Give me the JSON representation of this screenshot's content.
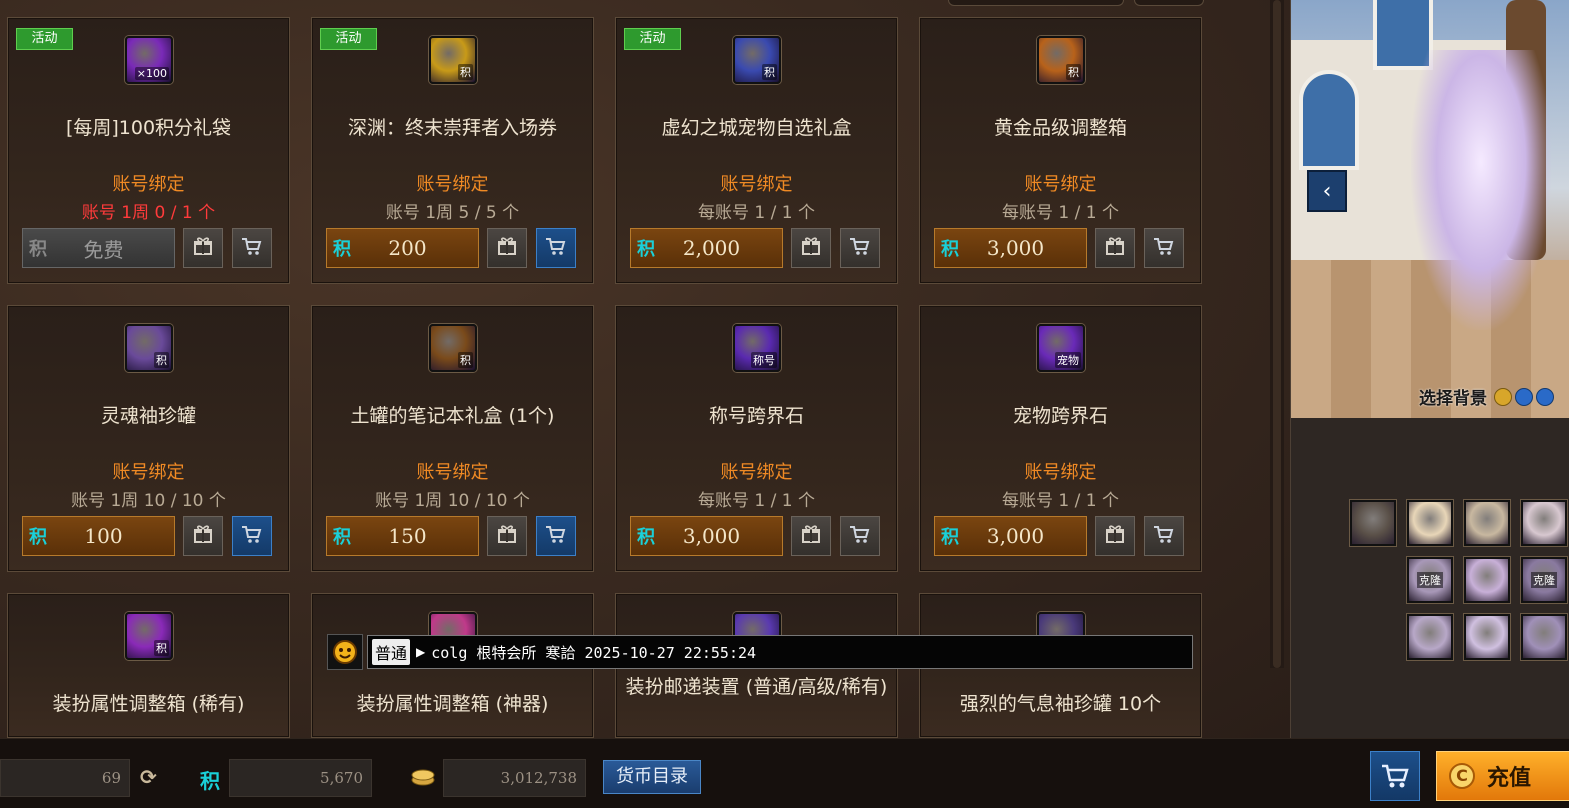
{
  "colors": {
    "accent_orange": "#f08a24",
    "limit_red": "#ff3b3b",
    "cart_blue": "#1d4f8a",
    "price_gold": "#7a4510",
    "event_green": "#2e9a2e"
  },
  "cards": [
    {
      "event": "活动",
      "icon_name": "points-bag-icon",
      "icon_badge": "×100",
      "icon_color": "#7a2ab8",
      "name": "[每周]100积分礼袋",
      "bind": "账号绑定",
      "limit": "账号 1周 0 / 1 个",
      "limit_red": true,
      "currency_symbol": "积",
      "price": "免费",
      "free": true,
      "cart_active": false
    },
    {
      "event": "活动",
      "icon_name": "ticket-icon",
      "icon_badge": "积",
      "icon_color": "#c89a18",
      "name": "深渊：终末崇拜者入场券",
      "bind": "账号绑定",
      "limit": "账号 1周 5 / 5 个",
      "limit_red": false,
      "currency_symbol": "积",
      "price": "200",
      "free": false,
      "cart_active": true
    },
    {
      "event": "活动",
      "icon_name": "pet-box-icon",
      "icon_badge": "积",
      "icon_color": "#3a4ab0",
      "name": "虚幻之城宠物自选礼盒",
      "bind": "账号绑定",
      "limit": "每账号 1 / 1 个",
      "limit_red": false,
      "currency_symbol": "积",
      "price": "2,000",
      "free": false,
      "cart_active": false
    },
    {
      "event": "",
      "icon_name": "gold-box-icon",
      "icon_badge": "积",
      "icon_color": "#b8621a",
      "name": "黄金品级调整箱",
      "bind": "账号绑定",
      "limit": "每账号 1 / 1 个",
      "limit_red": false,
      "currency_symbol": "积",
      "price": "3,000",
      "free": false,
      "cart_active": false
    },
    {
      "event": "",
      "icon_name": "jar-icon",
      "icon_badge": "积",
      "icon_color": "#6a4a9a",
      "name": "灵魂袖珍罐",
      "bind": "账号绑定",
      "limit": "账号 1周 10 / 10 个",
      "limit_red": false,
      "currency_symbol": "积",
      "price": "100",
      "free": false,
      "cart_active": true
    },
    {
      "event": "",
      "icon_name": "notebook-icon",
      "icon_badge": "积",
      "icon_color": "#7a4a1a",
      "name": "土罐的笔记本礼盒 (1个)",
      "bind": "账号绑定",
      "limit": "账号 1周 10 / 10 个",
      "limit_red": false,
      "currency_symbol": "积",
      "price": "150",
      "free": false,
      "cart_active": true
    },
    {
      "event": "",
      "icon_name": "title-stone-icon",
      "icon_badge": "称号",
      "icon_color": "#5a2ab0",
      "name": "称号跨界石",
      "bind": "账号绑定",
      "limit": "每账号 1 / 1 个",
      "limit_red": false,
      "currency_symbol": "积",
      "price": "3,000",
      "free": false,
      "cart_active": false
    },
    {
      "event": "",
      "icon_name": "pet-stone-icon",
      "icon_badge": "宠物",
      "icon_color": "#6a2ab8",
      "name": "宠物跨界石",
      "bind": "账号绑定",
      "limit": "每账号 1 / 1 个",
      "limit_red": false,
      "currency_symbol": "积",
      "price": "3,000",
      "free": false,
      "cart_active": false
    },
    {
      "event": "",
      "icon_name": "avatar-box-icon",
      "icon_badge": "积",
      "icon_color": "#8a2ab8",
      "name": "装扮属性调整箱 (稀有)",
      "bind": "",
      "limit": "",
      "limit_red": false,
      "currency_symbol": "",
      "price": "",
      "free": false,
      "cart_active": false
    },
    {
      "event": "",
      "icon_name": "avatar-box-artifact-icon",
      "icon_badge": "",
      "icon_color": "#c03a8a",
      "name": "装扮属性调整箱 (神器)",
      "bind": "",
      "limit": "",
      "limit_red": false,
      "currency_symbol": "",
      "price": "",
      "free": false,
      "cart_active": false
    },
    {
      "event": "",
      "icon_name": "mail-device-icon",
      "icon_badge": "",
      "icon_color": "#5a3ab0",
      "name": "装扮邮递装置 (普通/高级/稀有)",
      "bind": "",
      "limit": "",
      "limit_red": false,
      "currency_symbol": "",
      "price": "",
      "free": false,
      "cart_active": false
    },
    {
      "event": "",
      "icon_name": "aura-jar-icon",
      "icon_badge": "10",
      "icon_color": "#4a3a7a",
      "name": "强烈的气息袖珍罐 10个",
      "bind": "",
      "limit": "",
      "limit_red": false,
      "currency_symbol": "",
      "price": "",
      "free": false,
      "cart_active": false
    }
  ],
  "chat": {
    "channel": "普通",
    "message": "colg 根特会所 寒詥 2025-10-27 22:55:24"
  },
  "preview": {
    "select_bg_label": "选择背景"
  },
  "avatar_slots": [
    {
      "icon_name": "weapon-slot-icon",
      "badge": ""
    },
    {
      "icon_name": "hair-slot-icon",
      "badge": ""
    },
    {
      "icon_name": "cap-slot-icon",
      "badge": ""
    },
    {
      "icon_name": "face-slot-icon",
      "badge": ""
    },
    {
      "icon_name": "clone-slot-icon",
      "badge": "克隆"
    },
    {
      "icon_name": "coat-slot-icon",
      "badge": ""
    },
    {
      "icon_name": "clone-slot-2-icon",
      "badge": "克隆"
    },
    {
      "icon_name": "pants-slot-icon",
      "badge": ""
    },
    {
      "icon_name": "belt-slot-icon",
      "badge": ""
    },
    {
      "icon_name": "shoes-slot-icon",
      "badge": ""
    }
  ],
  "bottom": {
    "first_value": "69",
    "points_symbol": "积",
    "points_value": "5,670",
    "gold_value": "3,012,738",
    "currency_catalog_label": "货币目录",
    "recharge_label": "充值",
    "recharge_coin": "C"
  }
}
